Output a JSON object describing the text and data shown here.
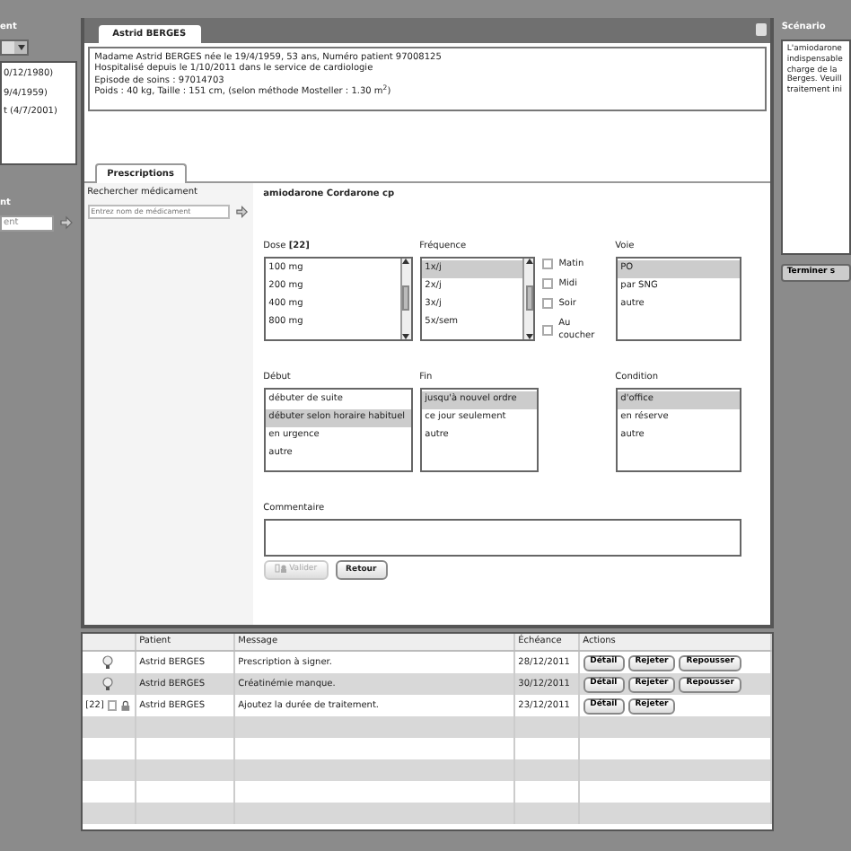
{
  "left_panel": {
    "title": "ent",
    "list": [
      "0/12/1980)",
      "9/4/1959)",
      "t (4/7/2001)"
    ],
    "search_label": "nt",
    "search_value": "ent"
  },
  "patient_tab": {
    "title": "Astrid BERGES"
  },
  "patient_info": [
    "Madame Astrid BERGES née le 19/4/1959, 53 ans, Numéro patient 97008125",
    "Hospitalisé depuis le 1/10/2011 dans le service de cardiologie",
    "Episode de soins : 97014703",
    "Poids : 40 kg, Taille : 151 cm, (selon méthode Mosteller : 1.30 m$^{2}$)"
  ],
  "tabs": [
    {
      "label": "Prescriptions",
      "selected": true
    }
  ],
  "search": {
    "label": "Rechercher médicament",
    "placeholder": "Entrez nom de médicament"
  },
  "drug_name": "amiodarone Cordarone cp",
  "dose": {
    "label": "Dose **[22]**",
    "options": [
      {
        "label": "100 mg",
        "selected": false
      },
      {
        "label": "200 mg",
        "selected": false
      },
      {
        "label": "400 mg",
        "selected": false
      },
      {
        "label": "800 mg",
        "selected": false
      }
    ]
  },
  "frequency": {
    "label": "Fréquence",
    "options": [
      {
        "label": "1x/j",
        "selected": true
      },
      {
        "label": "2x/j",
        "selected": false
      },
      {
        "label": "3x/j",
        "selected": false
      },
      {
        "label": "5x/sem",
        "selected": false
      }
    ]
  },
  "times": [
    {
      "label": "Matin",
      "checked": false
    },
    {
      "label": "Midi",
      "checked": false
    },
    {
      "label": "Soir",
      "checked": false
    },
    {
      "label": "Au coucher",
      "checked": false
    }
  ],
  "route": {
    "label": "Voie",
    "options": [
      {
        "label": "PO",
        "selected": true
      },
      {
        "label": "par SNG",
        "selected": false
      },
      {
        "label": "autre",
        "selected": false
      }
    ]
  },
  "start": {
    "label": "Début",
    "options": [
      {
        "label": "débuter de suite",
        "selected": false
      },
      {
        "label": "débuter selon horaire habituel",
        "selected": true
      },
      {
        "label": "en urgence",
        "selected": false
      },
      {
        "label": "autre",
        "selected": false
      }
    ]
  },
  "end": {
    "label": "Fin",
    "options": [
      {
        "label": "jusqu'à nouvel ordre",
        "selected": true
      },
      {
        "label": "ce jour seulement",
        "selected": false
      },
      {
        "label": "autre",
        "selected": false
      }
    ]
  },
  "condition": {
    "label": "Condition",
    "options": [
      {
        "label": "d'office",
        "selected": true
      },
      {
        "label": "en réserve",
        "selected": false
      },
      {
        "label": "autre",
        "selected": false
      }
    ]
  },
  "comment": {
    "label": "Commentaire"
  },
  "buttons": [
    {
      "label": "Valider",
      "disabled": true
    },
    {
      "label": "Retour",
      "disabled": false
    }
  ],
  "table": {
    "columns": [
      "Patient",
      "Message",
      "Échéance",
      "Actions"
    ],
    "rows": [
      {
        "kind": "bulb",
        "patient": "Astrid BERGES",
        "message": "Prescription à signer.",
        "due": "28/12/2011",
        "actions": [
          "Détail",
          "Rejeter",
          "Repousser"
        ]
      },
      {
        "kind": "bulb",
        "patient": "Astrid BERGES",
        "message": "Créatinémie manque.",
        "due": "30/12/2011",
        "actions": [
          "Détail",
          "Rejeter",
          "Repousser"
        ]
      },
      {
        "kind": "lock",
        "badge": "[22]",
        "checked": false,
        "patient": "Astrid BERGES",
        "message": "Ajoutez la durée de traitement.",
        "due": "23/12/2011",
        "actions": [
          "Détail",
          "Rejeter"
        ]
      }
    ]
  },
  "right_panel": {
    "title": "Scénario",
    "text_lines": [
      "L'amiodarone",
      "indispensable",
      "charge de la",
      "Berges. Veuill",
      "traitement ini"
    ],
    "button": "Terminer s"
  }
}
